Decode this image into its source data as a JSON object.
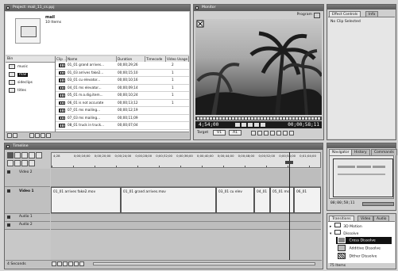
{
  "project": {
    "title": "Project: mail_11_cs.ppj",
    "name": "mail",
    "count": "10 Items",
    "bins_header": "Bin",
    "bins": [
      "music",
      "mail",
      "sideclips",
      "titles"
    ],
    "columns": [
      "Clip ..",
      "Name",
      "Duration",
      "Timecode",
      "Video Usage"
    ],
    "rows": [
      {
        "name": "01_01 grand arrives...",
        "duration": "00;00;29;26",
        "usage": "2"
      },
      {
        "name": "01_03 arrives fake2...",
        "duration": "00;00;15;10",
        "usage": "1"
      },
      {
        "name": "03_01 cu elevator...",
        "duration": "00;00;10;16",
        "usage": "1"
      },
      {
        "name": "04_01 ms elevator...",
        "duration": "00;00;09;14",
        "usage": "1"
      },
      {
        "name": "05_01 m.o.dig.item...",
        "duration": "00;00;10;24",
        "usage": "1"
      },
      {
        "name": "06_01 is not accurate",
        "duration": "00;00;13;12",
        "usage": "1"
      },
      {
        "name": "07_01 ms mailing...",
        "duration": "00;00;12;19",
        "usage": ""
      },
      {
        "name": "07_03 ms mailing...",
        "duration": "00;00;11;09",
        "usage": ""
      },
      {
        "name": "08_01 truck in truck...",
        "duration": "00;00;07;04",
        "usage": ""
      }
    ]
  },
  "monitor": {
    "title": "Monitor",
    "program_label": "Program",
    "timecode_left": "4;54;00",
    "timecode_right": "00;00;58;11",
    "target_label": "Target",
    "target_v": "V1",
    "target_a": "A1"
  },
  "effect_controls": {
    "tabs": [
      "Effect Controls",
      "Info"
    ],
    "message": "No Clip Selected"
  },
  "timeline": {
    "title": "Timeline",
    "ruler": [
      "4;28",
      "0;00;16;00",
      "0;00;20;00",
      "0;00;24;00",
      "0;00;28;00",
      "0;00;32;00",
      "0;00;36;00",
      "0;00;40;00",
      "0;00;44;00",
      "0;00;48;00",
      "0;00;52;00",
      "0;00;54;00",
      "0;01;04;00"
    ],
    "tracks": {
      "video2": "Video 2",
      "video1": "Video 1",
      "audio1": "Audio 1",
      "audio2": "Audio 2"
    },
    "clips": [
      {
        "label": "01_01 arrives fake2.mov"
      },
      {
        "label": "01_01 grand arrives.mov"
      },
      {
        "label": "03_01 cu elev"
      },
      {
        "label": "04_01"
      },
      {
        "label": "05_01 ms"
      },
      {
        "label": "06_01"
      }
    ],
    "zoom_label": "4 Seconds"
  },
  "navigator": {
    "tabs": [
      "Navigator",
      "History",
      "Commands"
    ],
    "timecode": "00;00;58;11"
  },
  "transitions": {
    "tabs": [
      "Transitions",
      "Video",
      "Audio"
    ],
    "folders": [
      "3D Motion",
      "Dissolve"
    ],
    "items": [
      "Cross Dissolve",
      "Additive Dissolve",
      "Dither Dissolve"
    ],
    "status": "75 Items"
  },
  "colors": {
    "accent": "#111111",
    "panel": "#cfcfcf",
    "titlebar": "#666666"
  }
}
